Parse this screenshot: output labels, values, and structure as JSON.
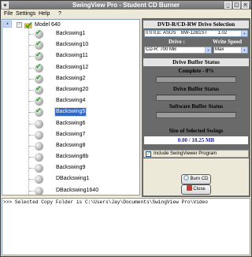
{
  "window": {
    "title": "SwingView Pro - Student CD Burner"
  },
  "menu": [
    "File",
    "Settings",
    "Help",
    "?"
  ],
  "tree": {
    "model": "Model 640",
    "items": [
      {
        "label": "Backswing1",
        "checked": true,
        "selected": false
      },
      {
        "label": "Backswing10",
        "checked": true,
        "selected": false
      },
      {
        "label": "Backswing11",
        "checked": true,
        "selected": false
      },
      {
        "label": "Backswing12",
        "checked": true,
        "selected": false
      },
      {
        "label": "Backswing2",
        "checked": true,
        "selected": false
      },
      {
        "label": "Backswing20",
        "checked": true,
        "selected": false
      },
      {
        "label": "Backswing4",
        "checked": true,
        "selected": false
      },
      {
        "label": "Backswing5",
        "checked": true,
        "selected": true
      },
      {
        "label": "Backswing6",
        "checked": false,
        "selected": false
      },
      {
        "label": "Backswing7",
        "checked": false,
        "selected": false
      },
      {
        "label": "Backswing8",
        "checked": false,
        "selected": false
      },
      {
        "label": "Backswing8b",
        "checked": false,
        "selected": false
      },
      {
        "label": "Backswing9",
        "checked": false,
        "selected": false
      },
      {
        "label": "DBackswing1",
        "checked": false,
        "selected": false
      },
      {
        "label": "DBackswing1640",
        "checked": false,
        "selected": false
      },
      {
        "label": "DBackswing1800",
        "checked": false,
        "selected": false
      },
      {
        "label": "DImpact1",
        "checked": false,
        "selected": false
      }
    ]
  },
  "drive": {
    "section_title": "DVD-R/CD-RW Drive Selection",
    "selected_drive": "0:0:0,E: ASUS    BW-12B1ST        1.02",
    "drive_label": "Drive :",
    "speed_label": "Write Speed",
    "media": "CD-R: 700 MB",
    "speed": "Max"
  },
  "buffer": {
    "section_title": "Drive Buffer Status",
    "complete_label": "Complete - 0%",
    "complete_percent": 0,
    "drive_buffer_label": "Drive Buffer Status",
    "drive_buffer_percent": 0,
    "software_buffer_label": "Software Buffer Status",
    "software_buffer_percent": 0,
    "size_label": "Size of Selected Swings",
    "size_value": "0.00 / 18.25 MB"
  },
  "include": {
    "label": "Include SwingViewer Program",
    "checked": true
  },
  "buttons": {
    "burn": "Burn CD",
    "close": "Close"
  },
  "log": ">>> Selected Copy Folder is C:\\Users\\Jay\\Documents\\SwingView Pro\\Video",
  "colors": {
    "selection": "#3168c5",
    "panel": "#6a6a6a",
    "size_value": "#2323c8"
  }
}
